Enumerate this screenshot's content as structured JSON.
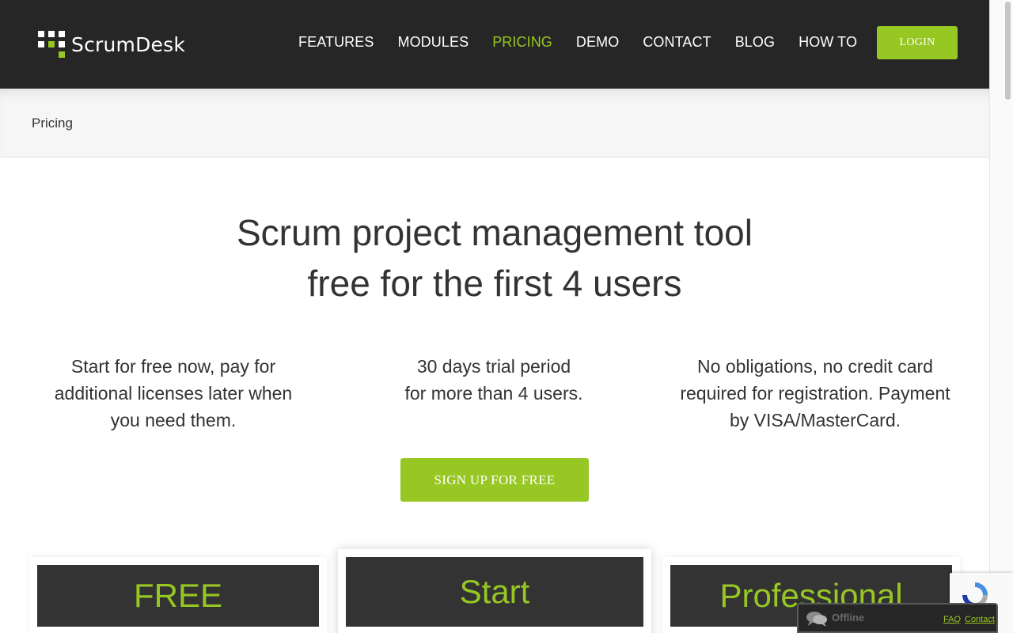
{
  "brand": {
    "name": "ScrumDesk",
    "accent_color": "#97c723",
    "header_bg": "#262626"
  },
  "nav": {
    "items": [
      {
        "label": "FEATURES",
        "active": false
      },
      {
        "label": "MODULES",
        "active": false
      },
      {
        "label": "PRICING",
        "active": true
      },
      {
        "label": "DEMO",
        "active": false
      },
      {
        "label": "CONTACT",
        "active": false
      },
      {
        "label": "BLOG",
        "active": false
      },
      {
        "label": "HOW TO",
        "active": false
      }
    ],
    "login_label": "LOGIN"
  },
  "breadcrumb": {
    "current": "Pricing"
  },
  "hero": {
    "title_line1": "Scrum project management tool",
    "title_line2": "free for the first 4 users"
  },
  "features": [
    {
      "lines": [
        "Start for free now, pay for",
        "additional licenses later when",
        "you need them."
      ]
    },
    {
      "lines": [
        "30 days trial period",
        "for more than 4 users."
      ]
    },
    {
      "lines": [
        "No obligations, no credit card",
        "required for registration. Payment",
        "by VISA/MasterCard."
      ]
    }
  ],
  "signup_label": "SIGN UP FOR FREE",
  "plans": [
    {
      "name": "FREE"
    },
    {
      "name": "Start"
    },
    {
      "name": "Professional"
    }
  ],
  "chat": {
    "status": "Offline",
    "faq_label": "FAQ",
    "contact_label": "Contact"
  },
  "icons": [
    "scrumdesk-logo-icon",
    "chat-bubbles-icon",
    "recaptcha-icon"
  ]
}
